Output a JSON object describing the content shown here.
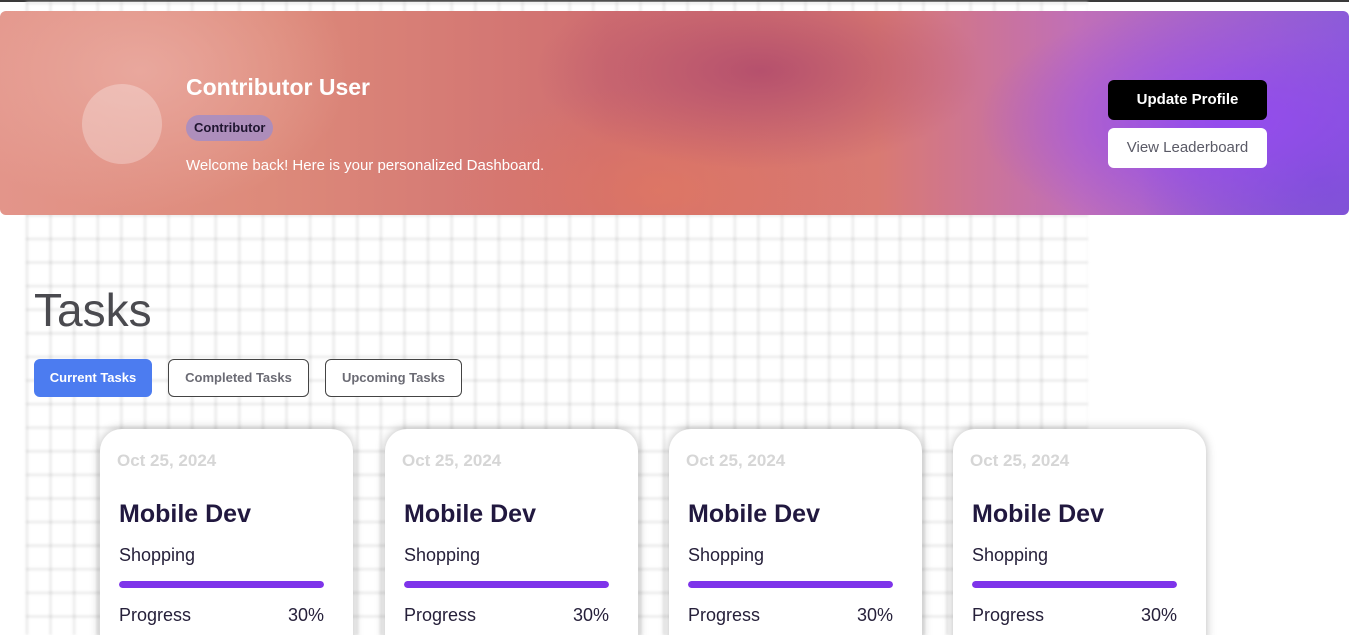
{
  "header": {
    "user_name": "Contributor User",
    "role": "Contributor",
    "welcome": "Welcome back! Here is your personalized Dashboard.",
    "update_profile_label": "Update Profile",
    "view_leaderboard_label": "View Leaderboard"
  },
  "page_title": "Tasks",
  "tabs": [
    {
      "label": "Current Tasks",
      "active": true
    },
    {
      "label": "Completed Tasks",
      "active": false
    },
    {
      "label": "Upcoming Tasks",
      "active": false
    }
  ],
  "tasks": [
    {
      "date": "Oct 25, 2024",
      "title": "Mobile Dev",
      "category": "Shopping",
      "progress_label": "Progress",
      "progress_text": "30%",
      "progress_fill_fraction": 1.0
    },
    {
      "date": "Oct 25, 2024",
      "title": "Mobile Dev",
      "category": "Shopping",
      "progress_label": "Progress",
      "progress_text": "30%",
      "progress_fill_fraction": 1.0
    },
    {
      "date": "Oct 25, 2024",
      "title": "Mobile Dev",
      "category": "Shopping",
      "progress_label": "Progress",
      "progress_text": "30%",
      "progress_fill_fraction": 1.0
    },
    {
      "date": "Oct 25, 2024",
      "title": "Mobile Dev",
      "category": "Shopping",
      "progress_label": "Progress",
      "progress_text": "30%",
      "progress_fill_fraction": 1.0
    }
  ],
  "colors": {
    "accent_tab": "#4c7cf0",
    "progress": "#7e34ea",
    "card_title": "#21183f",
    "button_primary": "#000000"
  }
}
